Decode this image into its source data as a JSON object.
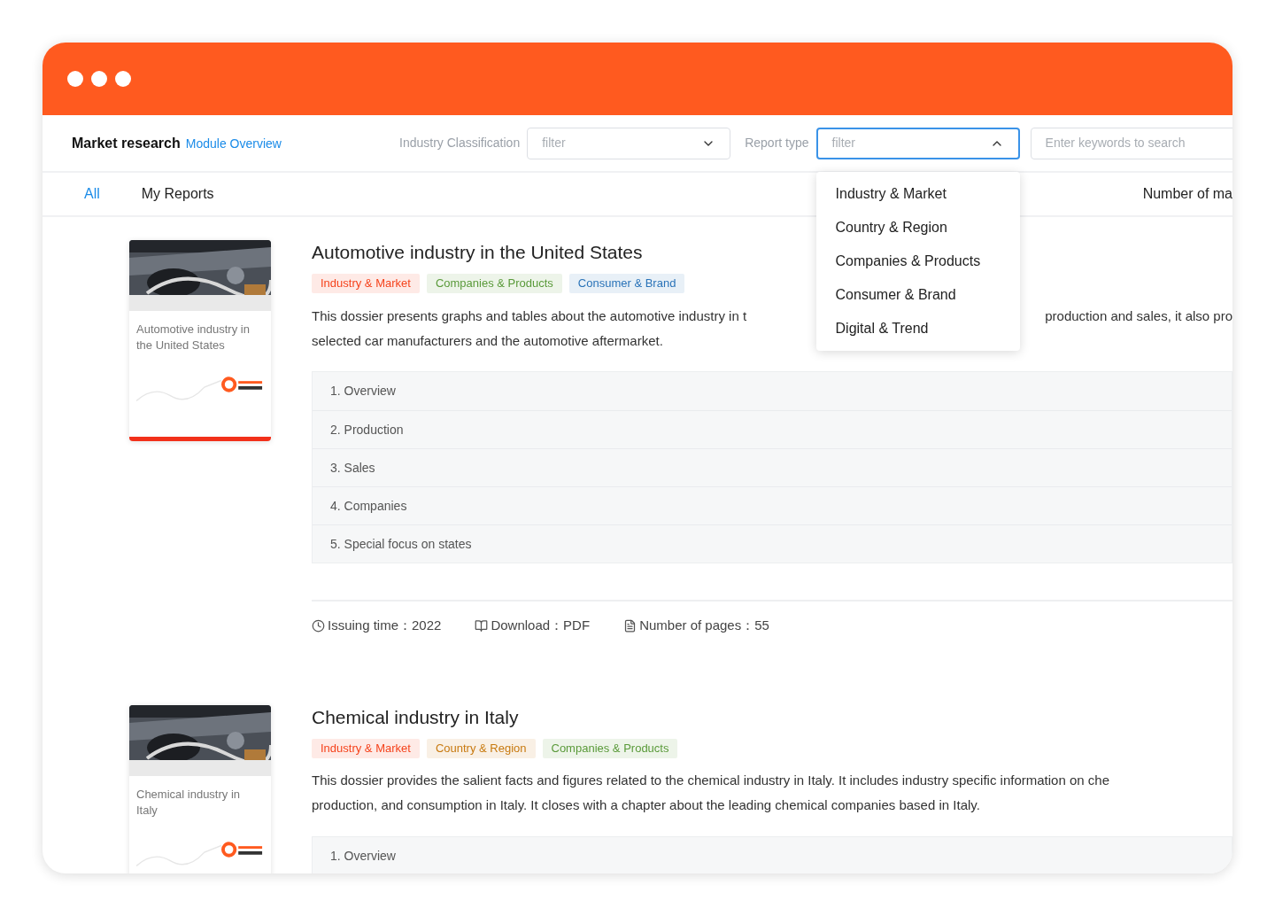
{
  "header": {
    "title": "Market research",
    "link": "Module Overview",
    "filters": [
      {
        "label": "Industry Classification",
        "placeholder": "filter",
        "expanded": false
      },
      {
        "label": "Report type",
        "placeholder": "filter",
        "expanded": true,
        "options": [
          "Industry & Market",
          "Country & Region",
          "Companies & Products",
          "Consumer & Brand",
          "Digital & Trend"
        ]
      }
    ],
    "search": {
      "placeholder": "Enter keywords to search"
    }
  },
  "tabs": [
    {
      "label": "All",
      "selected": true
    },
    {
      "label": "My Reports",
      "selected": false
    }
  ],
  "sort_label": "Number of ma",
  "reports": [
    {
      "cover_title": "Automotive industry in the United States",
      "title": "Automotive industry in the United States",
      "tags": [
        {
          "label": "Industry & Market",
          "color": "#f5431c"
        },
        {
          "label": "Companies & Products",
          "color": "#5a9a3a"
        },
        {
          "label": "Consumer & Brand",
          "color": "#2a73b8"
        }
      ],
      "description_lines": [
        [
          "This dossier presents graphs and tables about the automotive industry in t",
          "production and sales, it also pro"
        ],
        [
          "selected car manufacturers and the automotive aftermarket."
        ]
      ],
      "toc": [
        "1. Overview",
        "2. Production",
        "3. Sales",
        "4. Companies",
        "5. Special focus on states"
      ],
      "meta": [
        {
          "kind": "time",
          "text": "Issuing time：2022"
        },
        {
          "kind": "download",
          "text": "Download：PDF"
        },
        {
          "kind": "pages",
          "text": "Number of pages：55"
        }
      ]
    },
    {
      "cover_title": "Chemical industry in Italy",
      "title": "Chemical industry in Italy",
      "tags": [
        {
          "label": "Industry & Market",
          "color": "#f5431c"
        },
        {
          "label": "Country & Region",
          "color": "#c87a10"
        },
        {
          "label": "Companies & Products",
          "color": "#5a9a3a"
        }
      ],
      "description_lines": [
        [
          "This dossier provides the salient facts and figures related to the chemical industry in Italy. It includes industry specific information on che"
        ],
        [
          "production, and consumption in Italy. It closes with a chapter about the leading chemical companies based in Italy."
        ]
      ],
      "toc": [
        "1. Overview"
      ]
    }
  ]
}
